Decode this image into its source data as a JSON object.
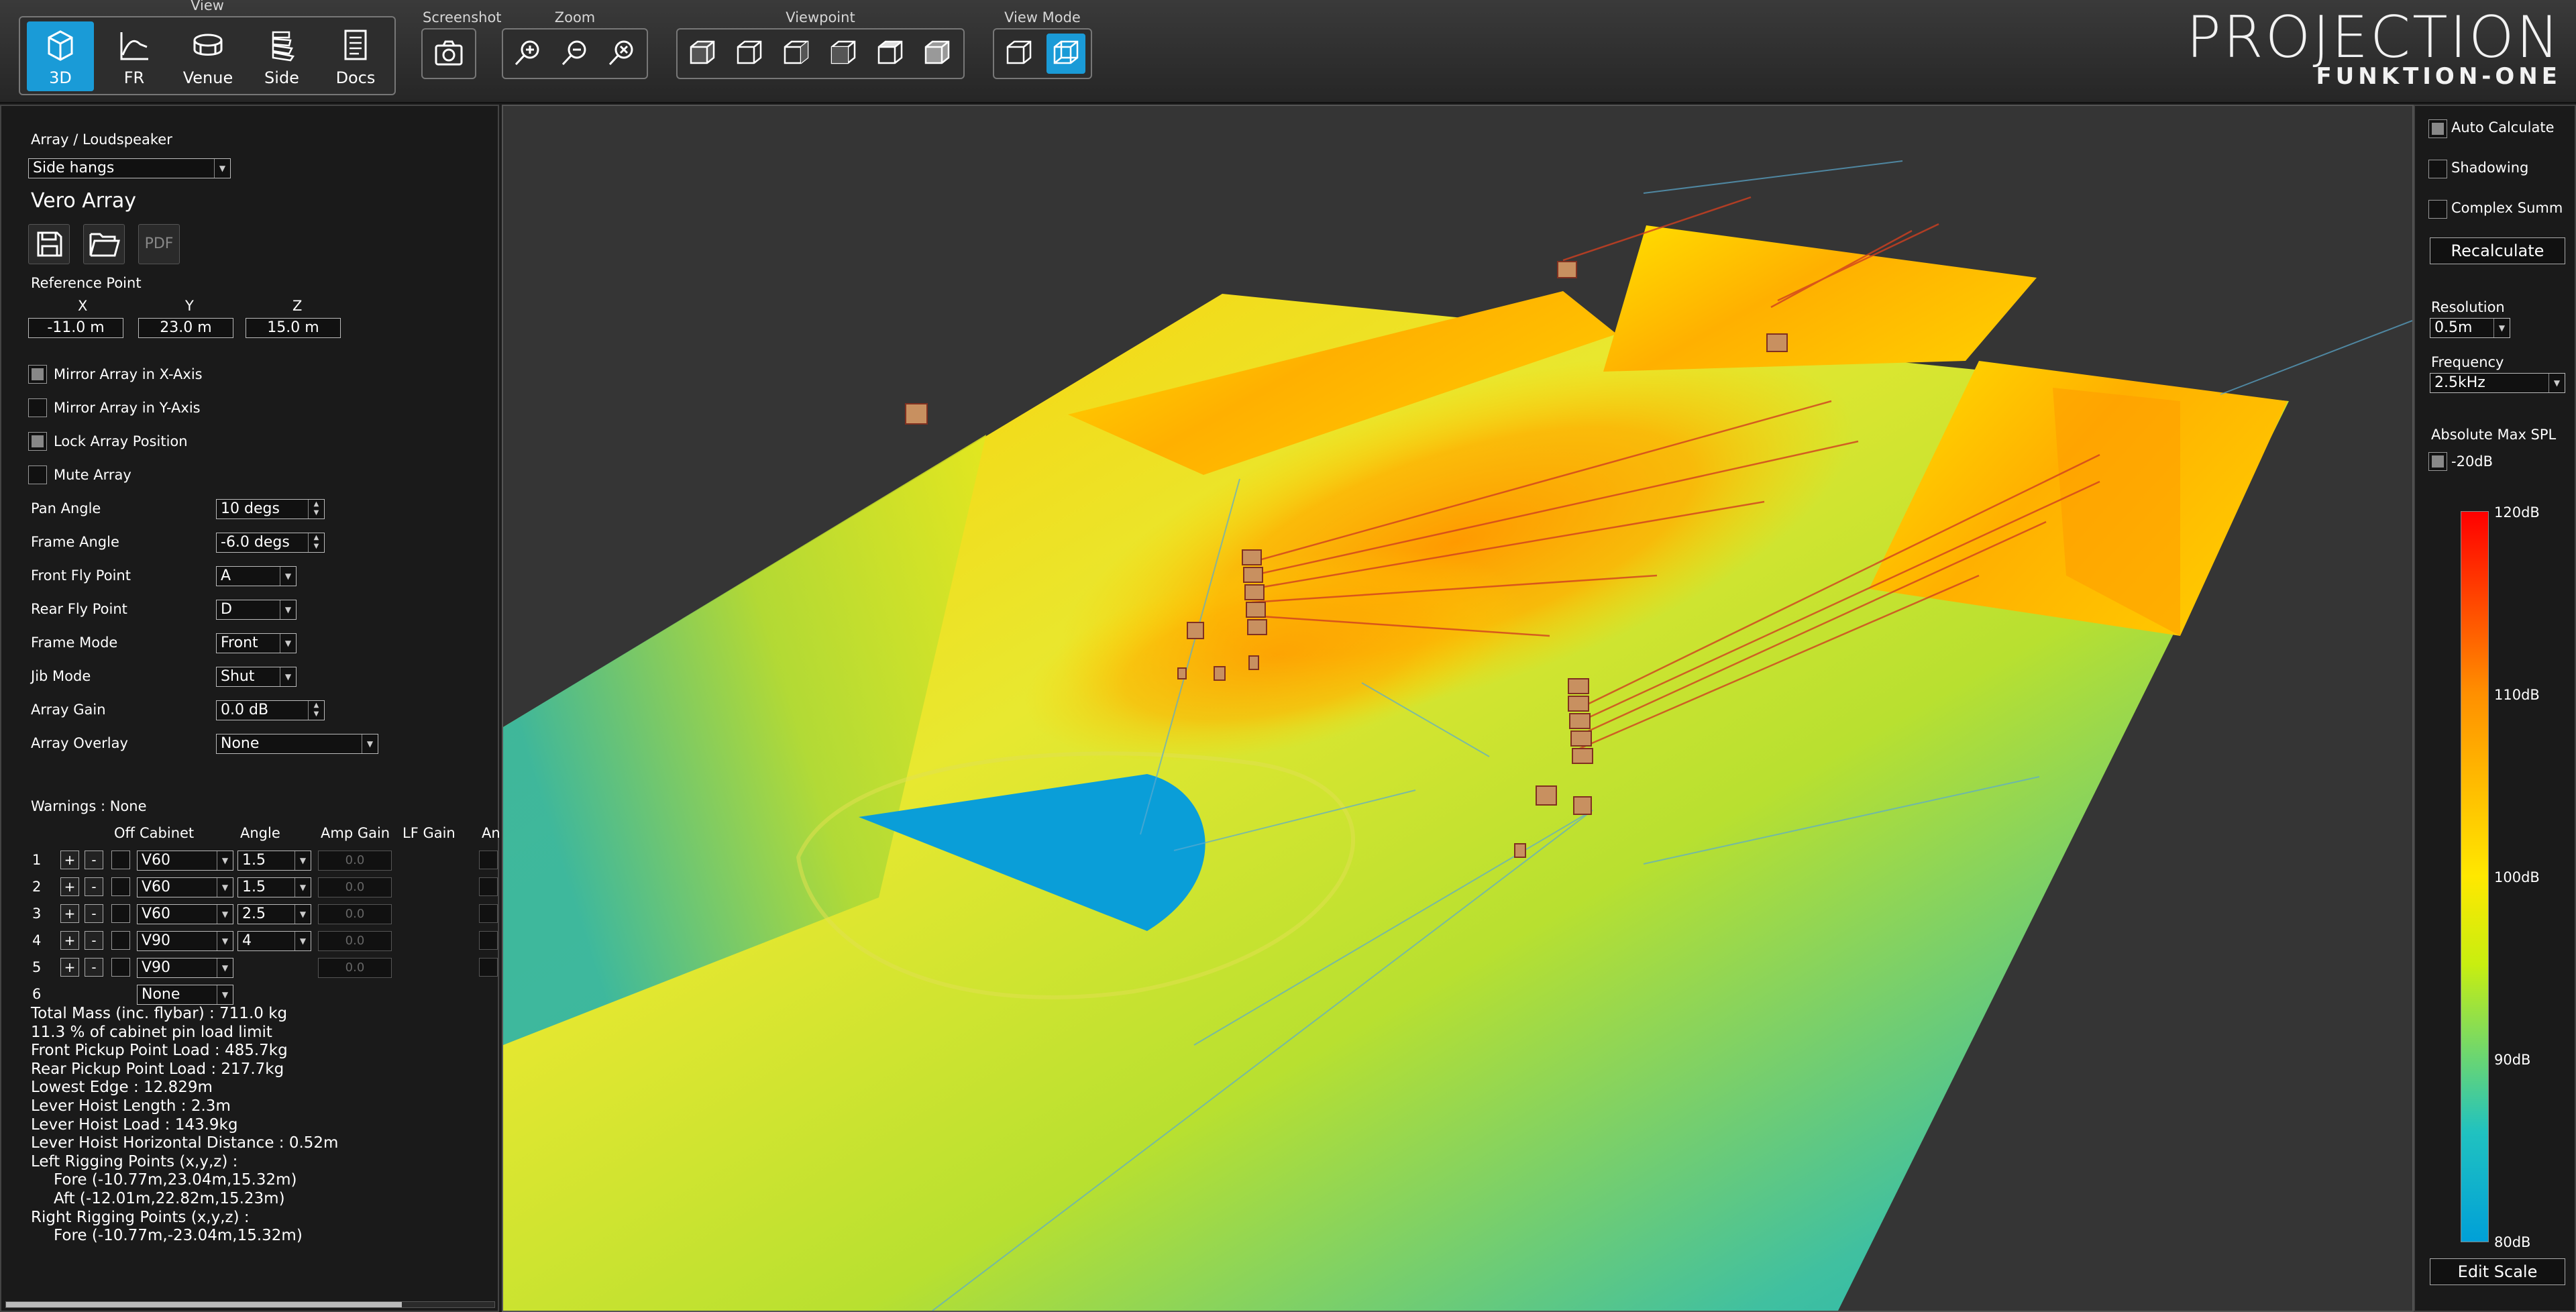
{
  "toolbar": {
    "view": {
      "label": "View",
      "buttons": [
        {
          "label": "3D",
          "icon": "cube-icon",
          "active": true
        },
        {
          "label": "FR",
          "icon": "frequency-response-icon",
          "active": false
        },
        {
          "label": "Venue",
          "icon": "venue-icon",
          "active": false
        },
        {
          "label": "Side",
          "icon": "side-view-icon",
          "active": false
        },
        {
          "label": "Docs",
          "icon": "docs-icon",
          "active": false
        }
      ]
    },
    "screenshot": {
      "label": "Screenshot",
      "icon": "camera-icon"
    },
    "zoom": {
      "label": "Zoom",
      "icons": [
        "zoom-in-icon",
        "zoom-out-icon",
        "zoom-reset-icon"
      ]
    },
    "viewpoint": {
      "label": "Viewpoint",
      "icons": [
        "viewpoint-front-icon",
        "viewpoint-back-icon",
        "viewpoint-left-icon",
        "viewpoint-right-icon",
        "viewpoint-top-icon",
        "viewpoint-iso-icon"
      ]
    },
    "viewmode": {
      "label": "View Mode",
      "icons": [
        "solid-mode-icon",
        "wireframe-mode-icon"
      ],
      "active_index": 1
    },
    "brand": {
      "title": "PROJECTION",
      "subtitle": "FUNKTION-ONE"
    }
  },
  "left": {
    "array_label": "Array / Loudspeaker",
    "array_select": "Side hangs",
    "array_name": "Vero Array",
    "pdf_label": "PDF",
    "ref_label": "Reference Point",
    "x_label": "X",
    "y_label": "Y",
    "z_label": "Z",
    "x_value": "-11.0 m",
    "y_value": "23.0 m",
    "z_value": "15.0 m",
    "checks": [
      {
        "label": "Mirror Array in X-Axis",
        "checked": true
      },
      {
        "label": "Mirror Array in Y-Axis",
        "checked": false
      },
      {
        "label": "Lock Array Position",
        "checked": true
      },
      {
        "label": "Mute Array",
        "checked": false
      }
    ],
    "params": [
      {
        "label": "Pan Angle",
        "value": "10 degs",
        "kind": "spin"
      },
      {
        "label": "Frame Angle",
        "value": "-6.0 degs",
        "kind": "spin"
      },
      {
        "label": "Front Fly Point",
        "value": "A",
        "kind": "combo"
      },
      {
        "label": "Rear Fly Point",
        "value": "D",
        "kind": "combo"
      },
      {
        "label": "Frame Mode",
        "value": "Front",
        "kind": "combo"
      },
      {
        "label": "Jib Mode",
        "value": "Shut",
        "kind": "combo"
      },
      {
        "label": "Array Gain",
        "value": "0.0 dB",
        "kind": "spin"
      },
      {
        "label": "Array Overlay",
        "value": "None",
        "kind": "combo"
      }
    ],
    "warnings": "Warnings : None",
    "table_headers": {
      "off": "Off",
      "cabinet": "Cabinet",
      "angle": "Angle",
      "amp_gain": "Amp Gain",
      "lf_gain": "LF Gain",
      "extra": "An"
    },
    "rows": [
      {
        "num": "1",
        "cabinet": "V60",
        "angle": "1.5",
        "amp": "0.0"
      },
      {
        "num": "2",
        "cabinet": "V60",
        "angle": "1.5",
        "amp": "0.0"
      },
      {
        "num": "3",
        "cabinet": "V60",
        "angle": "2.5",
        "amp": "0.0"
      },
      {
        "num": "4",
        "cabinet": "V90",
        "angle": "4",
        "amp": "0.0"
      },
      {
        "num": "5",
        "cabinet": "V90",
        "angle": "",
        "amp": "0.0"
      },
      {
        "num": "6",
        "cabinet": "None",
        "angle": "",
        "amp": ""
      }
    ],
    "stats": [
      "Total Mass (inc. flybar) : 711.0 kg",
      "11.3 % of cabinet pin load limit",
      "Front Pickup Point Load : 485.7kg",
      "Rear Pickup Point Load : 217.7kg",
      "Lowest Edge : 12.829m",
      "Lever Hoist Length : 2.3m",
      "Lever Hoist Load : 143.9kg",
      "Lever Hoist Horizontal Distance : 0.52m",
      "Left Rigging Points (x,y,z) :",
      "Fore (-10.77m,23.04m,15.32m)",
      "Aft (-12.01m,22.82m,15.23m)",
      "Right Rigging Points (x,y,z) :",
      "Fore (-10.77m,-23.04m,15.32m)"
    ]
  },
  "right": {
    "auto_calc": "Auto Calculate",
    "shadowing": "Shadowing",
    "complex_summ": "Complex Summ",
    "recalculate": "Recalculate",
    "resolution_label": "Resolution",
    "resolution_value": "0.5m",
    "frequency_label": "Frequency",
    "frequency_value": "2.5kHz",
    "abs_max_label": "Absolute Max SPL",
    "abs_max_value": "-20dB",
    "scale_labels": [
      "120dB",
      "110dB",
      "100dB",
      "90dB",
      "80dB"
    ],
    "edit_scale": "Edit Scale",
    "colors": {
      "max": "#ff0000",
      "mid": "#ffe800",
      "min": "#00a0d8"
    }
  }
}
